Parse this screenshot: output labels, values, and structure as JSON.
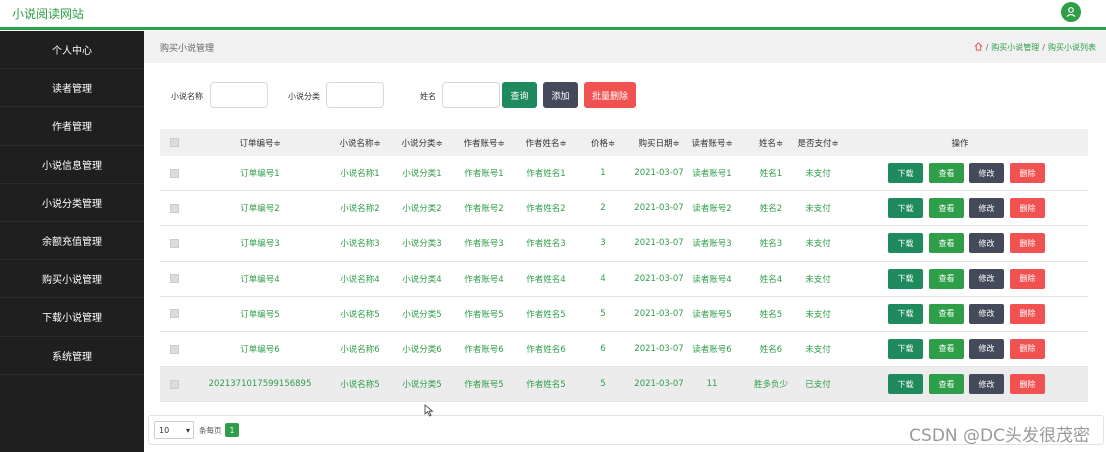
{
  "app": {
    "title": "小说阅读网站"
  },
  "sidebar": {
    "items": [
      {
        "label": "个人中心"
      },
      {
        "label": "读者管理"
      },
      {
        "label": "作者管理"
      },
      {
        "label": "小说信息管理"
      },
      {
        "label": "小说分类管理"
      },
      {
        "label": "余额充值管理"
      },
      {
        "label": "购买小说管理"
      },
      {
        "label": "下载小说管理"
      },
      {
        "label": "系统管理"
      }
    ]
  },
  "header": {
    "title": "购买小说管理",
    "breadcrumb": [
      "购买小说管理",
      "购买小说列表"
    ]
  },
  "search": {
    "novel_name_label": "小说名称",
    "novel_category_label": "小说分类",
    "name_label": "姓名",
    "query_button": "查询",
    "add_button": "添加",
    "batch_delete_button": "批量删除"
  },
  "table": {
    "headers": [
      "订单编号≑",
      "小说名称≑",
      "小说分类≑",
      "作者账号≑",
      "作者姓名≑",
      "价格≑",
      "购买日期≑",
      "读者账号≑",
      "姓名≑",
      "是否支付≑",
      "操作"
    ],
    "rows": [
      [
        "订单编号1",
        "小说名称1",
        "小说分类1",
        "作者账号1",
        "作者姓名1",
        "1",
        "2021-03-07",
        "读者账号1",
        "姓名1",
        "未支付"
      ],
      [
        "订单编号2",
        "小说名称2",
        "小说分类2",
        "作者账号2",
        "作者姓名2",
        "2",
        "2021-03-07",
        "读者账号2",
        "姓名2",
        "未支付"
      ],
      [
        "订单编号3",
        "小说名称3",
        "小说分类3",
        "作者账号3",
        "作者姓名3",
        "3",
        "2021-03-07",
        "读者账号3",
        "姓名3",
        "未支付"
      ],
      [
        "订单编号4",
        "小说名称4",
        "小说分类4",
        "作者账号4",
        "作者姓名4",
        "4",
        "2021-03-07",
        "读者账号4",
        "姓名4",
        "未支付"
      ],
      [
        "订单编号5",
        "小说名称5",
        "小说分类5",
        "作者账号5",
        "作者姓名5",
        "5",
        "2021-03-07",
        "读者账号5",
        "姓名5",
        "未支付"
      ],
      [
        "订单编号6",
        "小说名称6",
        "小说分类6",
        "作者账号6",
        "作者姓名6",
        "6",
        "2021-03-07",
        "读者账号6",
        "姓名6",
        "未支付"
      ],
      [
        "2021371017599156895",
        "小说名称5",
        "小说分类5",
        "作者账号5",
        "作者姓名5",
        "5",
        "2021-03-07",
        "11",
        "胜多负少",
        "已支付"
      ]
    ],
    "row_actions": [
      "下载",
      "查看",
      "修改",
      "删除"
    ]
  },
  "pagination": {
    "page_size": "10",
    "per_page_label": "条每页",
    "current_page": "1"
  },
  "watermark": "CSDN @DC头发很茂密",
  "colors": {
    "accent": "#2e9e48",
    "download": "#1e8a5e",
    "view": "#2e9e48",
    "edit": "#454a5a",
    "delete": "#f05252",
    "sidebar": "#1f1f1f"
  }
}
